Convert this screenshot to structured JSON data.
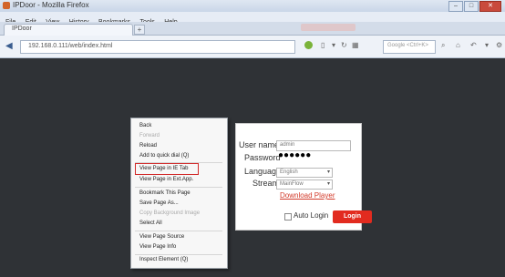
{
  "window": {
    "title": "IPDoor - Mozilla Firefox"
  },
  "menubar": [
    "File",
    "Edit",
    "View",
    "History",
    "Bookmarks",
    "Tools",
    "Help"
  ],
  "tabs": [
    {
      "label": "IPDoor"
    }
  ],
  "newtab_label": "+",
  "navbar": {
    "url": "192.168.0.111/web/index.html",
    "search_placeholder": "Google <Ctrl+K>"
  },
  "context_menu": {
    "items": [
      {
        "label": "Back",
        "enabled": true
      },
      {
        "label": "Forward",
        "enabled": false
      },
      {
        "label": "Reload",
        "enabled": true
      },
      {
        "label": "Add to quick dial (Q)",
        "enabled": true
      },
      {
        "label": "View Page in IE Tab",
        "enabled": true,
        "highlighted": true
      },
      {
        "label": "View Page in Ext.App.",
        "enabled": true
      },
      {
        "label": "Bookmark This Page",
        "enabled": true
      },
      {
        "label": "Save Page As...",
        "enabled": true
      },
      {
        "label": "Copy Background Image",
        "enabled": false
      },
      {
        "label": "Select All",
        "enabled": true
      },
      {
        "label": "View Page Source",
        "enabled": true
      },
      {
        "label": "View Page Info",
        "enabled": true
      },
      {
        "label": "Inspect Element (Q)",
        "enabled": true
      }
    ]
  },
  "login": {
    "username_label": "User name",
    "username_value": "admin",
    "password_label": "Password",
    "password_value": "●●●●●●",
    "language_label": "Language",
    "language_value": "English",
    "stream_label": "Stream",
    "stream_value": "MainFlow",
    "download_link": "Download Player",
    "auto_login_label": "Auto Login",
    "login_button": "Login"
  },
  "colors": {
    "accent": "#e22b1f",
    "content_bg": "#2f3236",
    "highlight_border": "#d22a2a"
  }
}
